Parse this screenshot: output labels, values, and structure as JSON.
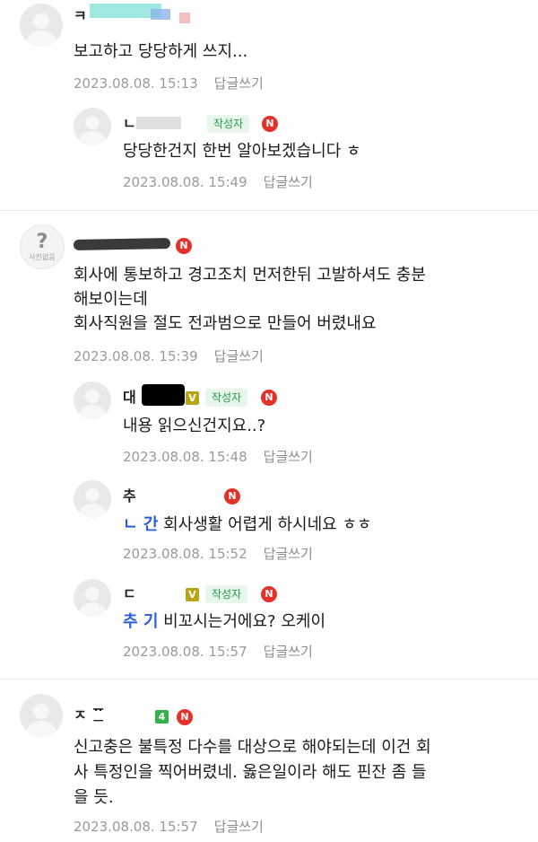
{
  "comments": [
    {
      "nick": "ㅋ",
      "text": "보고하고 당당하게 쓰지...",
      "time": "2023.08.08. 15:13",
      "reply": "답글쓰기"
    },
    {
      "nick": "ㄴ",
      "writer_badge": "작성자",
      "n_badge": "N",
      "text": "당당한건지 한번 알아보겠습니다 ㅎ",
      "time": "2023.08.08. 15:49",
      "reply": "답글쓰기"
    },
    {
      "avatar_caption": "사진없음",
      "n_badge": "N",
      "lines": [
        "회사에 통보하고 경고조치 먼저한뒤 고발하셔도 충분",
        "해보이는데",
        "회사직원을 절도 전과범으로 만들어 버렸내요"
      ],
      "time": "2023.08.08. 15:39",
      "reply": "답글쓰기"
    },
    {
      "nick": "대",
      "v_badge": "V",
      "writer_badge": "작성자",
      "n_badge": "N",
      "text": "내용 읽으신건지요..?",
      "time": "2023.08.08. 15:48",
      "reply": "답글쓰기"
    },
    {
      "nick": "추",
      "n_badge": "N",
      "mention": "ㄴ 간",
      "text": "회사생활 어렵게 하시네요 ㅎㅎ",
      "time": "2023.08.08. 15:52",
      "reply": "답글쓰기"
    },
    {
      "nick": "ㄷ",
      "v_badge": "V",
      "writer_badge": "작성자",
      "n_badge": "N",
      "mention": "추 기",
      "text": "비꼬시는거에요? 오케이",
      "time": "2023.08.08. 15:57",
      "reply": "답글쓰기"
    },
    {
      "nick": "ㅈ 푼",
      "level_badge": "4",
      "n_badge": "N",
      "lines": [
        "신고충은 불특정 다수를 대상으로 해야되는데 이건 회",
        "사 특정인을 찍어버렸네. 옳은일이라 해도 핀잔 좀 들",
        "을 듯."
      ],
      "time": "2023.08.08. 15:57",
      "reply": "답글쓰기"
    }
  ]
}
